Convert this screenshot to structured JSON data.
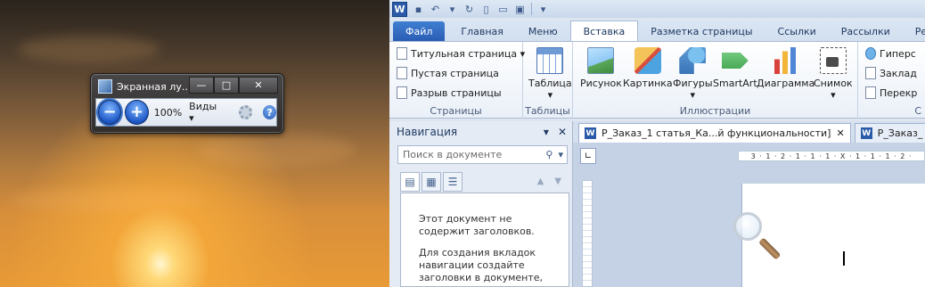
{
  "magnifier": {
    "title": "Экранная лу...",
    "zoom": "100%",
    "views_label": "Виды ▾",
    "window_buttons": [
      "—",
      "□",
      "✕"
    ]
  },
  "word": {
    "app_letter": "W",
    "tabs": {
      "file": "Файл",
      "home": "Главная",
      "menu": "Меню",
      "insert": "Вставка",
      "layout": "Разметка страницы",
      "references": "Ссылки",
      "mailings": "Рассылки",
      "review": "Рецензи"
    },
    "groups": {
      "pages": {
        "label": "Страницы",
        "items": [
          "Титульная страница ▾",
          "Пустая страница",
          "Разрыв страницы"
        ]
      },
      "tables": {
        "label": "Таблицы",
        "button": "Таблица",
        "arrow": "▾"
      },
      "illustrations": {
        "label": "Иллюстрации",
        "buttons": [
          "Рисунок",
          "Картинка",
          "Фигуры",
          "SmartArt",
          "Диаграмма",
          "Снимок"
        ],
        "arrows": [
          "",
          "",
          "▾",
          "",
          "",
          "▾"
        ]
      },
      "links": {
        "items": [
          "Гиперс",
          "Заклад",
          "Перекр"
        ],
        "label": "С"
      }
    },
    "navigation": {
      "title": "Навигация",
      "controls": [
        "▾",
        "✕"
      ],
      "search_placeholder": "Поиск в документе",
      "message1": "Этот документ не содержит заголовков.",
      "message2": "Для создания вкладок навигации создайте заголовки в документе,"
    },
    "doc_tabs": [
      {
        "title": "Р_Заказ_1 статья_Ка...й функциональности]",
        "close": "✕"
      },
      {
        "title": "Р_Заказ_",
        "close": ""
      }
    ],
    "ruler_corner": "∟",
    "ruler_text": "3 · 1 · 2 · 1 · 1 · 1 · X · 1 · 1 · 1 · 2 ·"
  }
}
